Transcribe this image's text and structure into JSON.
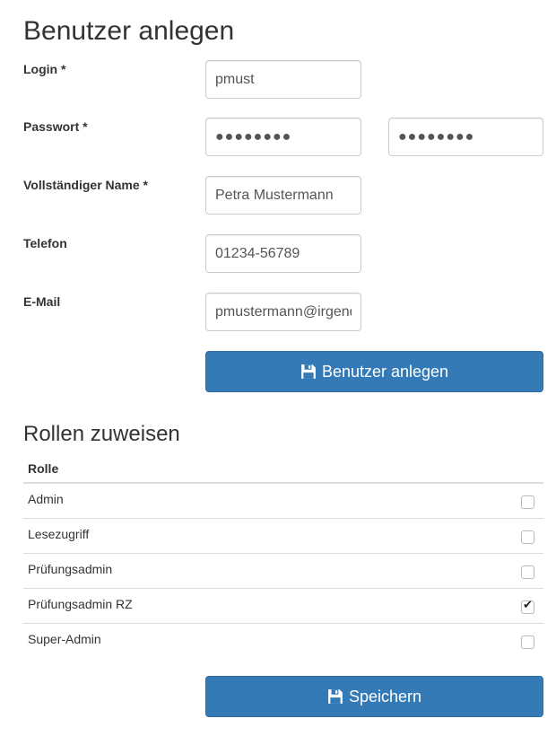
{
  "page_title": "Benutzer anlegen",
  "form": {
    "login": {
      "label": "Login *",
      "value": "pmust"
    },
    "password": {
      "label": "Passwort *",
      "value": "●●●●●●●●",
      "confirm_value": "●●●●●●●●"
    },
    "fullname": {
      "label": "Vollständiger Name *",
      "value": "Petra Mustermann"
    },
    "phone": {
      "label": "Telefon",
      "value": "01234-56789"
    },
    "email": {
      "label": "E-Mail",
      "value": "pmustermann@irgend"
    },
    "submit_label": "Benutzer anlegen"
  },
  "roles": {
    "title": "Rollen zuweisen",
    "column_header": "Rolle",
    "items": [
      {
        "label": "Admin",
        "checked": false
      },
      {
        "label": "Lesezugriff",
        "checked": false
      },
      {
        "label": "Prüfungsadmin",
        "checked": false
      },
      {
        "label": "Prüfungsadmin RZ",
        "checked": true
      },
      {
        "label": "Super-Admin",
        "checked": false
      }
    ],
    "save_label": "Speichern"
  },
  "colors": {
    "primary": "#337ab7",
    "border": "#cccccc"
  },
  "icons": {
    "save": "floppy-disk-icon"
  }
}
